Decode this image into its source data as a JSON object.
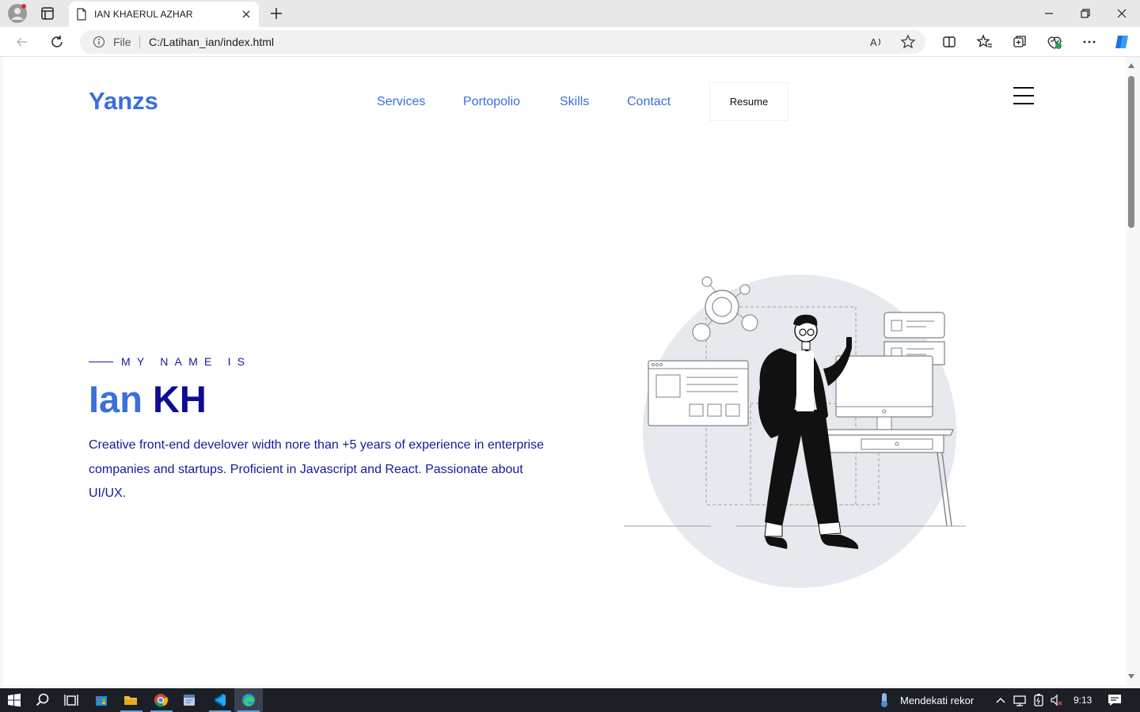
{
  "browser": {
    "tab_title": "IAN KHAERUL AZHAR",
    "address_scheme_label": "File",
    "address_url": "C:/Latihan_ian/index.html"
  },
  "page": {
    "logo": "Yanzs",
    "nav": [
      "Services",
      "Portopolio",
      "Skills",
      "Contact"
    ],
    "resume_button": "Resume",
    "eyebrow": "MY NAME IS",
    "name_first": "Ian",
    "name_last": "KH",
    "bio": "Creative front-end develover width nore than +5 years of experience in enterprise companies and startups. Proficient in Javascript and React. Passionate about UI/UX."
  },
  "taskbar": {
    "weather_text": "Mendekati rekor",
    "clock": "9:13"
  },
  "colors": {
    "primary_blue": "#3a6fde",
    "navy": "#0d0c92",
    "text_blue": "#1419a0",
    "illustration_circle": "#e6e9ed"
  }
}
